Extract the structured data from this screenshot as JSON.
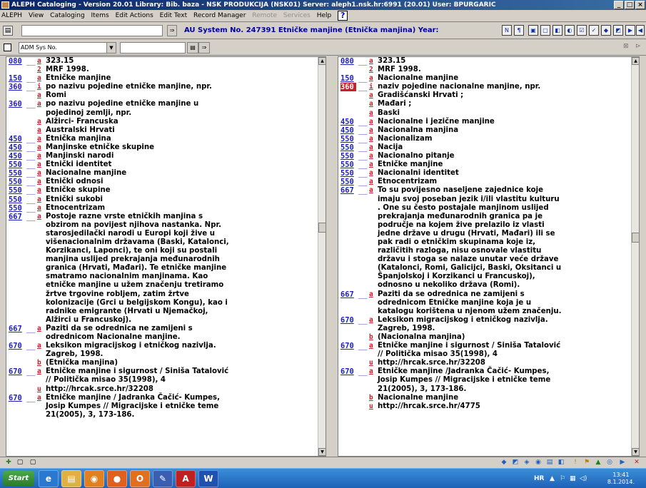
{
  "window": {
    "title": "ALEPH Cataloging - Version 20.01 Library: Bib. baza - NSK PRODUKCIJA (NSK01) Server: aleph1.nsk.hr:6991 (20.01) User: BPURGARIC",
    "controls": [
      "_",
      "□",
      "×"
    ]
  },
  "menu": {
    "items": [
      "ALEPH",
      "View",
      "Cataloging",
      "Items",
      "Edit Actions",
      "Edit Text",
      "Record Manager"
    ],
    "disabled_items": [
      "Remote",
      "Services"
    ],
    "help_item": "Help"
  },
  "toolbar": {
    "record_info": "AU System No. 247391 Etničke manjine (Etnička manjina) Year:",
    "icons": [
      "tb-a",
      "tb-b",
      "tb-c",
      "tb-d",
      "tb-e",
      "tb-f",
      "tb-g",
      "tb-h",
      "tb-i",
      "tb-j",
      "tb-k",
      "tb-l"
    ]
  },
  "search": {
    "field_label": "ADM Sys No.",
    "value": ""
  },
  "left_record": {
    "rows": [
      {
        "tag": "080",
        "ind": "__",
        "sub": "a",
        "text": "323.15"
      },
      {
        "tag": "",
        "ind": "",
        "sub": "2",
        "text": "MRF 1998."
      },
      {
        "tag": "150",
        "ind": "__",
        "sub": "a",
        "text": "Etničke manjine"
      },
      {
        "tag": "360",
        "ind": "__",
        "sub": "i",
        "text": "po nazivu pojedine etničke manjine, npr."
      },
      {
        "tag": "",
        "ind": "",
        "sub": "a",
        "text": "Romi"
      },
      {
        "tag": "360",
        "ind": "__",
        "sub": "a",
        "text": "po nazivu pojedine etničke manjine u"
      },
      {
        "tag": "",
        "ind": "",
        "sub": "",
        "text": "pojedinoj zemlji, npr."
      },
      {
        "tag": "",
        "ind": "",
        "sub": "a",
        "text": "Alžirci- Francuska"
      },
      {
        "tag": "",
        "ind": "",
        "sub": "a",
        "text": "Australski Hrvati"
      },
      {
        "tag": "450",
        "ind": "__",
        "sub": "a",
        "text": "Etnička manjina"
      },
      {
        "tag": "450",
        "ind": "__",
        "sub": "a",
        "text": "Manjinske etničke skupine"
      },
      {
        "tag": "450",
        "ind": "__",
        "sub": "a",
        "text": "Manjinski narodi"
      },
      {
        "tag": "550",
        "ind": "__",
        "sub": "a",
        "text": "Etnički identitet"
      },
      {
        "tag": "550",
        "ind": "__",
        "sub": "a",
        "text": "Nacionalne manjine"
      },
      {
        "tag": "550",
        "ind": "__",
        "sub": "a",
        "text": "Etnički odnosi"
      },
      {
        "tag": "550",
        "ind": "__",
        "sub": "a",
        "text": "Etničke skupine"
      },
      {
        "tag": "550",
        "ind": "__",
        "sub": "a",
        "text": "Etnički sukobi"
      },
      {
        "tag": "550",
        "ind": "__",
        "sub": "a",
        "text": "Etnocentrizam"
      },
      {
        "tag": "667",
        "ind": "__",
        "sub": "a",
        "text": "Postoje razne vrste etničkih manjina s"
      },
      {
        "tag": "",
        "ind": "",
        "sub": "",
        "text": "obzirom na povijest njihova nastanka. Npr."
      },
      {
        "tag": "",
        "ind": "",
        "sub": "",
        "text": "starosjedilački narodi u Europi koji žive u"
      },
      {
        "tag": "",
        "ind": "",
        "sub": "",
        "text": "višenacionalnim državama (Baski, Katalonci,"
      },
      {
        "tag": "",
        "ind": "",
        "sub": "",
        "text": "Korzikanci, Laponci), te oni koji su postali"
      },
      {
        "tag": "",
        "ind": "",
        "sub": "",
        "text": "manjina uslijed prekrajanja međunarodnih"
      },
      {
        "tag": "",
        "ind": "",
        "sub": "",
        "text": "granica (Hrvati, Mađari). Te etničke manjine"
      },
      {
        "tag": "",
        "ind": "",
        "sub": "",
        "text": "smatramo nacionalnim manjinama. Kao"
      },
      {
        "tag": "",
        "ind": "",
        "sub": "",
        "text": "etničke manjine u užem značenju tretiramo"
      },
      {
        "tag": "",
        "ind": "",
        "sub": "",
        "text": "žrtve trgovine robljem, zatim žrtve"
      },
      {
        "tag": "",
        "ind": "",
        "sub": "",
        "text": "kolonizacije (Grci u belgijskom Kongu), kao i"
      },
      {
        "tag": "",
        "ind": "",
        "sub": "",
        "text": "radnike emigrante (Hrvati u Njemačkoj,"
      },
      {
        "tag": "",
        "ind": "",
        "sub": "",
        "text": "Alžirci u Francuskoj)."
      },
      {
        "tag": "667",
        "ind": "__",
        "sub": "a",
        "text": "Paziti da se odrednica ne zamijeni s"
      },
      {
        "tag": "",
        "ind": "",
        "sub": "",
        "text": "odrednicom Nacionalne manjine."
      },
      {
        "tag": "670",
        "ind": "__",
        "sub": "a",
        "text": "Leksikon migracijskog i etničkog nazivlja."
      },
      {
        "tag": "",
        "ind": "",
        "sub": "",
        "text": "Zagreb, 1998."
      },
      {
        "tag": "",
        "ind": "",
        "sub": "b",
        "text": "(Etnička manjina)"
      },
      {
        "tag": "670",
        "ind": "__",
        "sub": "a",
        "text": "Etničke manjine i sigurnost / Siniša Tatalović"
      },
      {
        "tag": "",
        "ind": "",
        "sub": "",
        "text": "// Politička misao 35(1998), 4"
      },
      {
        "tag": "",
        "ind": "",
        "sub": "u",
        "text": "http://hrcak.srce.hr/32208"
      },
      {
        "tag": "670",
        "ind": "__",
        "sub": "a",
        "text": "Etničke manjine / Jadranka Čačić- Kumpes,"
      },
      {
        "tag": "",
        "ind": "",
        "sub": "",
        "text": "Josip Kumpes // Migracijske i etničke teme"
      },
      {
        "tag": "",
        "ind": "",
        "sub": "",
        "text": "21(2005), 3, 173-186."
      }
    ]
  },
  "right_record": {
    "rows": [
      {
        "tag": "080",
        "ind": "__",
        "sub": "a",
        "text": "323.15",
        "hl": false
      },
      {
        "tag": "",
        "ind": "",
        "sub": "2",
        "text": "MRF 1998.",
        "hl": false
      },
      {
        "tag": "150",
        "ind": "__",
        "sub": "a",
        "text": "Nacionalne manjine",
        "hl": false
      },
      {
        "tag": "360",
        "ind": "__",
        "sub": "i",
        "text": "naziv pojedine nacionalne manjine, npr.",
        "hl": true
      },
      {
        "tag": "",
        "ind": "",
        "sub": "a",
        "text": "Gradišćanski Hrvati ;",
        "hl": false
      },
      {
        "tag": "",
        "ind": "",
        "sub": "a",
        "text": "Mađari ;",
        "hl": false
      },
      {
        "tag": "",
        "ind": "",
        "sub": "a",
        "text": "Baski",
        "hl": false
      },
      {
        "tag": "450",
        "ind": "__",
        "sub": "a",
        "text": "Nacionalne i jezične manjine",
        "hl": false
      },
      {
        "tag": "450",
        "ind": "__",
        "sub": "a",
        "text": "Nacionalna manjina",
        "hl": false
      },
      {
        "tag": "550",
        "ind": "__",
        "sub": "a",
        "text": "Nacionalizam",
        "hl": false
      },
      {
        "tag": "550",
        "ind": "__",
        "sub": "a",
        "text": "Nacija",
        "hl": false
      },
      {
        "tag": "550",
        "ind": "__",
        "sub": "a",
        "text": "Nacionalno pitanje",
        "hl": false
      },
      {
        "tag": "550",
        "ind": "__",
        "sub": "a",
        "text": "Etničke manjine",
        "hl": false
      },
      {
        "tag": "550",
        "ind": "__",
        "sub": "a",
        "text": "Nacionalni identitet",
        "hl": false
      },
      {
        "tag": "550",
        "ind": "__",
        "sub": "a",
        "text": "Etnocentrizam",
        "hl": false
      },
      {
        "tag": "667",
        "ind": "__",
        "sub": "a",
        "text": "To su povijesno naseljene zajednice koje",
        "hl": false
      },
      {
        "tag": "",
        "ind": "",
        "sub": "",
        "text": "imaju svoj poseban jezik i/ili vlastitu kulturu",
        "hl": false
      },
      {
        "tag": "",
        "ind": "",
        "sub": "",
        "text": ". One su često postajale manjinom uslijed",
        "hl": false
      },
      {
        "tag": "",
        "ind": "",
        "sub": "",
        "text": "prekrajanja međunarodnih granica pa je",
        "hl": false
      },
      {
        "tag": "",
        "ind": "",
        "sub": "",
        "text": "područje na kojem žive prelazilo iz vlasti",
        "hl": false
      },
      {
        "tag": "",
        "ind": "",
        "sub": "",
        "text": "jedne države u drugu (Hrvati, Mađari) ili se",
        "hl": false
      },
      {
        "tag": "",
        "ind": "",
        "sub": "",
        "text": "pak radi o etničkim skupinama koje iz,",
        "hl": false
      },
      {
        "tag": "",
        "ind": "",
        "sub": "",
        "text": "različitih razloga, nisu osnovale vlastitu",
        "hl": false
      },
      {
        "tag": "",
        "ind": "",
        "sub": "",
        "text": "državu i stoga se nalaze unutar veće države",
        "hl": false
      },
      {
        "tag": "",
        "ind": "",
        "sub": "",
        "text": "(Katalonci, Romi, Galicijci, Baski, Oksitanci u",
        "hl": false
      },
      {
        "tag": "",
        "ind": "",
        "sub": "",
        "text": "Španjolskoj i Korzikanci u Francuskoj),",
        "hl": false
      },
      {
        "tag": "",
        "ind": "",
        "sub": "",
        "text": "odnosno u nekoliko država (Romi).",
        "hl": false
      },
      {
        "tag": "667",
        "ind": "__",
        "sub": "a",
        "text": "Paziti da se odrednica ne zamijeni s",
        "hl": false
      },
      {
        "tag": "",
        "ind": "",
        "sub": "",
        "text": "odrednicom Etničke manjine koja je u",
        "hl": false
      },
      {
        "tag": "",
        "ind": "",
        "sub": "",
        "text": "katalogu korištena u njenom užem značenju.",
        "hl": false
      },
      {
        "tag": "670",
        "ind": "__",
        "sub": "a",
        "text": "Leksikon migracijskog i etničkog nazivlja.",
        "hl": false
      },
      {
        "tag": "",
        "ind": "",
        "sub": "",
        "text": "Zagreb, 1998.",
        "hl": false
      },
      {
        "tag": "",
        "ind": "",
        "sub": "b",
        "text": "(Nacionalna manjina)",
        "hl": false
      },
      {
        "tag": "670",
        "ind": "__",
        "sub": "a",
        "text": "Etničke manjine i sigurnost / Siniša Tatalović",
        "hl": false
      },
      {
        "tag": "",
        "ind": "",
        "sub": "",
        "text": "// Politička misao 35(1998), 4",
        "hl": false
      },
      {
        "tag": "",
        "ind": "",
        "sub": "u",
        "text": "http://hrcak.srce.hr/32208",
        "hl": false
      },
      {
        "tag": "670",
        "ind": "__",
        "sub": "a",
        "text": "Etničke manjine /Jadranka Čačić- Kumpes,",
        "hl": false
      },
      {
        "tag": "",
        "ind": "",
        "sub": "",
        "text": "Josip Kumpes // Migracijske i etničke teme",
        "hl": false
      },
      {
        "tag": "",
        "ind": "",
        "sub": "",
        "text": "21(2005), 3, 173-186.",
        "hl": false
      },
      {
        "tag": "",
        "ind": "",
        "sub": "b",
        "text": "Nacionalne manjine",
        "hl": false
      },
      {
        "tag": "",
        "ind": "",
        "sub": "u",
        "text": "http://hrcak.srce.hr/4775",
        "hl": false
      }
    ]
  },
  "taskbar": {
    "start_label": "Start",
    "apps": [
      "ie-icon",
      "folder-icon",
      "media-icon",
      "firefox-icon",
      "outlook-icon",
      "aleph-icon",
      "pdf-icon",
      "word-icon"
    ],
    "app_glyphs": [
      "e",
      "▤",
      "◉",
      "●",
      "O",
      "✎",
      "A",
      "W"
    ],
    "tray_lang": "HR",
    "clock_time": "13:41",
    "clock_date": "8.1.2014."
  },
  "colors": {
    "tag": "#2020c0",
    "subfield": "#c8202a",
    "highlight": "#c8202a"
  }
}
